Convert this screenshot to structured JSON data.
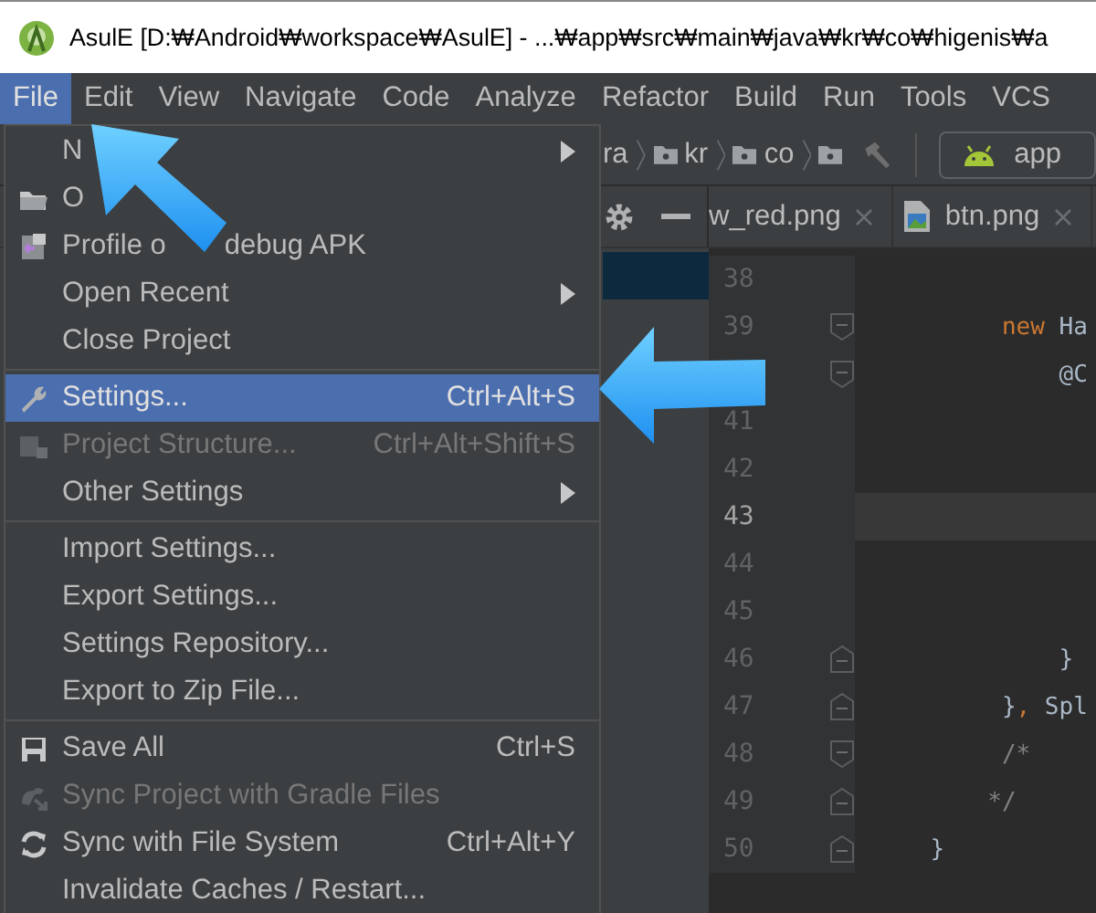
{
  "window": {
    "title": "AsulE [D:₩Android₩workspace₩AsulE] - ...₩app₩src₩main₩java₩kr₩co₩higenis₩a"
  },
  "menu_bar": [
    {
      "label": "File",
      "selected": true
    },
    {
      "label": "Edit",
      "selected": false
    },
    {
      "label": "View",
      "selected": false
    },
    {
      "label": "Navigate",
      "selected": false
    },
    {
      "label": "Code",
      "selected": false
    },
    {
      "label": "Analyze",
      "selected": false
    },
    {
      "label": "Refactor",
      "selected": false
    },
    {
      "label": "Build",
      "selected": false
    },
    {
      "label": "Run",
      "selected": false
    },
    {
      "label": "Tools",
      "selected": false
    },
    {
      "label": "VCS",
      "selected": false
    }
  ],
  "file_menu": [
    {
      "kind": "item",
      "label": "N",
      "submenu": true,
      "selected": false,
      "disabled": false
    },
    {
      "kind": "item",
      "label": "O",
      "selected": false,
      "disabled": false
    },
    {
      "kind": "item",
      "label": "Profile o",
      "label_after": "debug APK",
      "selected": false,
      "disabled": false
    },
    {
      "kind": "item",
      "label": "Open Recent",
      "submenu": true,
      "selected": false,
      "disabled": false
    },
    {
      "kind": "item",
      "label": "Close Project",
      "selected": false,
      "disabled": false
    },
    {
      "kind": "separator"
    },
    {
      "kind": "item",
      "label": "Settings...",
      "shortcut": "Ctrl+Alt+S",
      "selected": true,
      "disabled": false
    },
    {
      "kind": "item",
      "label": "Project Structure...",
      "shortcut": "Ctrl+Alt+Shift+S",
      "selected": false,
      "disabled": true
    },
    {
      "kind": "item",
      "label": "Other Settings",
      "submenu": true,
      "selected": false,
      "disabled": false
    },
    {
      "kind": "separator"
    },
    {
      "kind": "item",
      "label": "Import Settings...",
      "selected": false,
      "disabled": false
    },
    {
      "kind": "item",
      "label": "Export Settings...",
      "selected": false,
      "disabled": false
    },
    {
      "kind": "item",
      "label": "Settings Repository...",
      "selected": false,
      "disabled": false
    },
    {
      "kind": "item",
      "label": "Export to Zip File...",
      "selected": false,
      "disabled": false
    },
    {
      "kind": "separator"
    },
    {
      "kind": "item",
      "label": "Save All",
      "shortcut": "Ctrl+S",
      "selected": false,
      "disabled": false
    },
    {
      "kind": "item",
      "label": "Sync Project with Gradle Files",
      "selected": false,
      "disabled": true
    },
    {
      "kind": "item",
      "label": "Sync with File System",
      "shortcut": "Ctrl+Alt+Y",
      "selected": false,
      "disabled": false
    },
    {
      "kind": "item",
      "label": "Invalidate Caches / Restart...",
      "selected": false,
      "disabled": false
    }
  ],
  "breadcrumbs": [
    "ra",
    "kr",
    "co"
  ],
  "run_config": {
    "label": "app"
  },
  "editor_tabs": [
    {
      "label": "w_red.png",
      "selected": false
    },
    {
      "label": "btn.png",
      "selected": false
    }
  ],
  "code_lines": [
    {
      "number": "38",
      "current": false,
      "kind": "plain"
    },
    {
      "number": "39",
      "current": false,
      "kind": "fold-start",
      "segments": [
        {
          "kind": "keyword",
          "text": "         new"
        },
        {
          "kind": "plain",
          "text": " Ha"
        }
      ]
    },
    {
      "current": false,
      "kind": "fold-start",
      "segments": [
        {
          "kind": "plain",
          "text": "             @C"
        }
      ]
    },
    {
      "number": "41",
      "current": false,
      "kind": "plain"
    },
    {
      "number": "42",
      "current": false,
      "kind": "plain"
    },
    {
      "number": "43",
      "current": true,
      "kind": "plain"
    },
    {
      "number": "44",
      "current": false,
      "kind": "plain"
    },
    {
      "number": "45",
      "current": false,
      "kind": "plain"
    },
    {
      "number": "46",
      "current": false,
      "kind": "fold-end",
      "segments": [
        {
          "kind": "plain",
          "text": "             }"
        }
      ]
    },
    {
      "number": "47",
      "current": false,
      "kind": "fold-end",
      "segments": [
        {
          "kind": "plain",
          "text": "         }"
        },
        {
          "kind": "keyword",
          "text": ","
        },
        {
          "kind": "plain",
          "text": " Spl"
        }
      ]
    },
    {
      "number": "48",
      "current": false,
      "kind": "fold-start",
      "segments": [
        {
          "kind": "comment",
          "text": "         /*"
        }
      ]
    },
    {
      "number": "49",
      "current": false,
      "kind": "fold-end",
      "segments": [
        {
          "kind": "comment",
          "text": "        */"
        }
      ]
    },
    {
      "number": "50",
      "current": false,
      "kind": "fold-end",
      "segments": [
        {
          "kind": "plain",
          "text": "    }"
        }
      ]
    }
  ]
}
